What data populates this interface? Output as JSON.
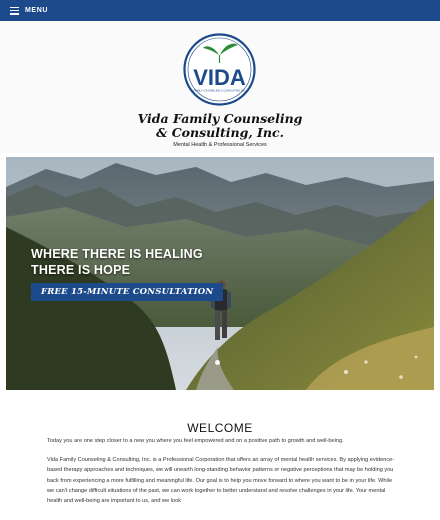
{
  "nav": {
    "menu_label": "MENU"
  },
  "brand": {
    "logo_text": "VIDA",
    "logo_ring_text": "FAMILY COUNSELING & CONSULTING INC",
    "name_line1": "Vida Family Counseling",
    "name_line2": "& Consulting, Inc.",
    "tagline": "Mental Health & Professional Services",
    "colors": {
      "primary": "#1d4a8a",
      "leaf": "#2e8b3a"
    }
  },
  "hero": {
    "title_line1": "WHERE THERE IS HEALING",
    "title_line2": "THERE IS HOPE",
    "cta_label": "FREE 15-MINUTE CONSULTATION"
  },
  "welcome": {
    "heading": "WELCOME",
    "intro": "Today you are one step closer to a new you where you feel empowered and on a positive path to growth and well-being.",
    "body": "Vida Family Counseling & Consulting, Inc. is a Professional Corporation that offers an array of mental health services. By applying evidence-based therapy approaches and techniques, we will unearth long-standing behavior patterns or negative perceptions that may be holding you back from experiencing a more fulfilling and meaningful life.  Our goal is to help you move forward to where you want to be in your life. While we can't change difficult situations of the past, we can work together to better understand and resolve challenges in your life. Your mental health and well-being are important to us, and we look"
  },
  "icons": {
    "menu": "hamburger-icon",
    "logo_leaf": "leaf-icon"
  }
}
